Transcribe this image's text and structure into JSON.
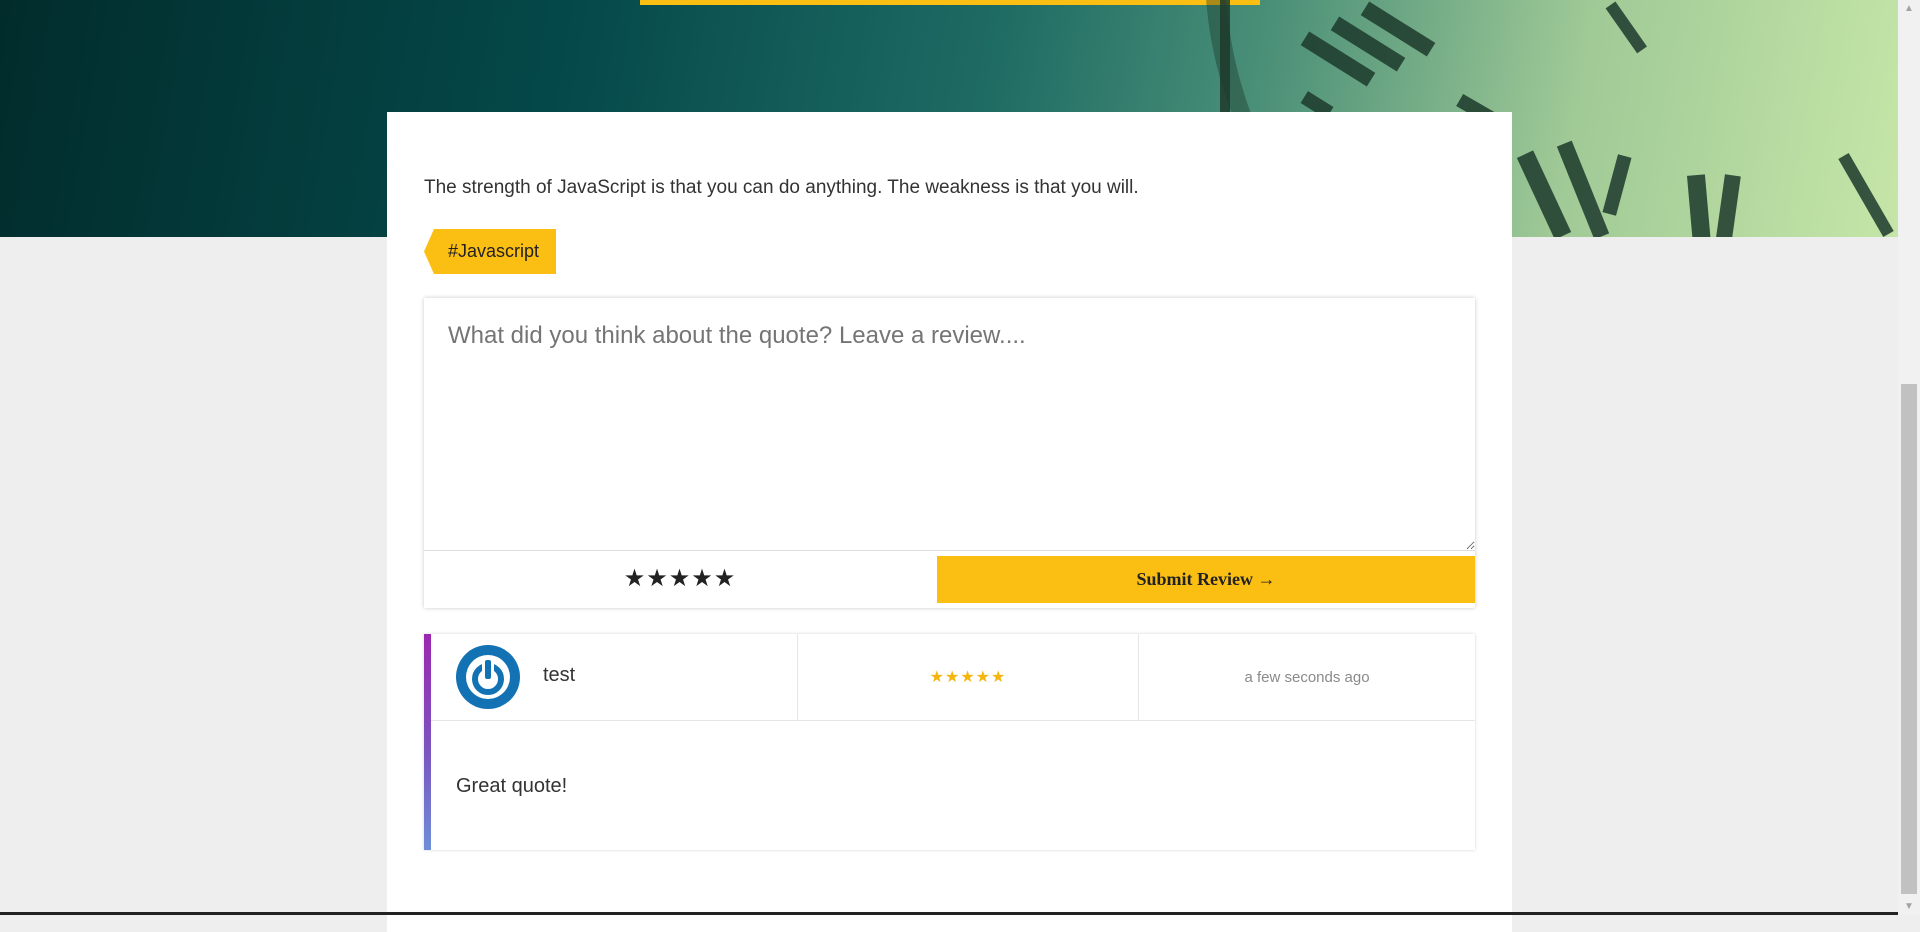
{
  "quote": {
    "text": "The strength of JavaScript is that you can do anything. The weakness is that you will.",
    "tag": "#Javascript"
  },
  "review_form": {
    "placeholder": "What did you think about the quote? Leave a review....",
    "rating_stars": "★★★★★",
    "submit_label": "Submit Review →"
  },
  "reviews": [
    {
      "username": "test",
      "rating_stars": "★★★★★",
      "rating": 5,
      "time": "a few seconds ago",
      "body": "Great quote!"
    }
  ],
  "colors": {
    "accent": "#fbbf14",
    "avatar": "#1372b3",
    "review_stripe_top": "#9c27b0",
    "review_stripe_bottom": "#6e8fd8"
  },
  "icons": {
    "avatar": "power-icon",
    "scroll_up": "chevron-up-icon",
    "scroll_down": "chevron-down-icon"
  }
}
